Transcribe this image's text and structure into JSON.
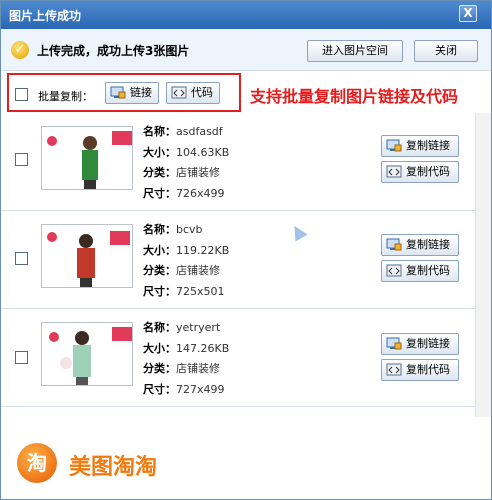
{
  "window": {
    "title": "图片上传成功",
    "close_glyph": "X"
  },
  "status": {
    "message": "上传完成，成功上传3张图片",
    "open_space_label": "进入图片空间",
    "close_label": "关闭"
  },
  "batch": {
    "label": "批量复制：",
    "link_label": "链接",
    "code_label": "代码",
    "promo": "支持批量复制图片链接及代码"
  },
  "keys": {
    "name": "名称：",
    "size": "大小：",
    "category": "分类：",
    "dims": "尺寸："
  },
  "row_buttons": {
    "copy_link": "复制链接",
    "copy_code": "复制代码"
  },
  "items": [
    {
      "name": "asdfasdf",
      "size": "104.63KB",
      "category": "店铺装修",
      "dims": "726x499"
    },
    {
      "name": "bcvb",
      "size": "119.22KB",
      "category": "店铺装修",
      "dims": "725x501"
    },
    {
      "name": "yetryert",
      "size": "147.26KB",
      "category": "店铺装修",
      "dims": "727x499"
    }
  ],
  "brand": {
    "logo_char": "淘",
    "name": "美图淘淘"
  },
  "colors": {
    "accent_red": "#e02020",
    "brand_orange": "#f07a10",
    "title_blue": "#2a67b4"
  },
  "icons": [
    "check-icon",
    "link-icon",
    "code-icon",
    "close-icon",
    "brand-logo-icon"
  ]
}
